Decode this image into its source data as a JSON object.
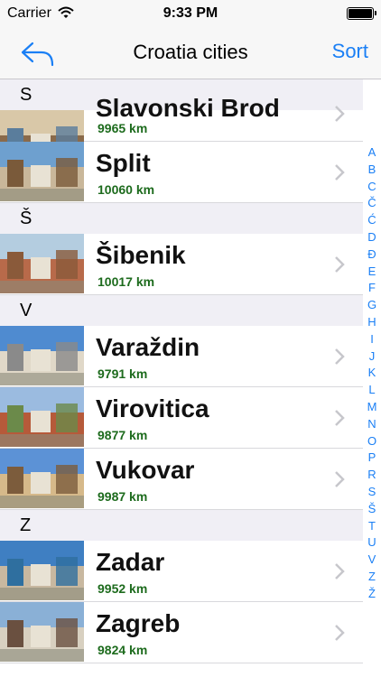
{
  "status": {
    "carrier": "Carrier",
    "time": "9:33 PM"
  },
  "nav": {
    "title": "Croatia cities",
    "sort_label": "Sort"
  },
  "sections": [
    {
      "letter": "S",
      "rows": [
        {
          "name": "Slavonski Brod",
          "distance": "9965 km",
          "partial": true
        },
        {
          "name": "Split",
          "distance": "10060 km"
        }
      ]
    },
    {
      "letter": "Š",
      "rows": [
        {
          "name": "Šibenik",
          "distance": "10017 km"
        }
      ]
    },
    {
      "letter": "V",
      "rows": [
        {
          "name": "Varaždin",
          "distance": "9791 km"
        },
        {
          "name": "Virovitica",
          "distance": "9877 km"
        },
        {
          "name": "Vukovar",
          "distance": "9987 km"
        }
      ]
    },
    {
      "letter": "Z",
      "rows": [
        {
          "name": "Zadar",
          "distance": "9952 km"
        },
        {
          "name": "Zagreb",
          "distance": "9824 km"
        }
      ]
    }
  ],
  "index": [
    "A",
    "B",
    "C",
    "Č",
    "Ć",
    "D",
    "Đ",
    "E",
    "F",
    "G",
    "H",
    "I",
    "J",
    "K",
    "L",
    "M",
    "N",
    "O",
    "P",
    "R",
    "S",
    "Š",
    "T",
    "U",
    "V",
    "Z",
    "Ž"
  ],
  "colors": {
    "accent": "#1a7ff5",
    "distance": "#1d6b1d",
    "section_bg": "#f0eff5"
  }
}
